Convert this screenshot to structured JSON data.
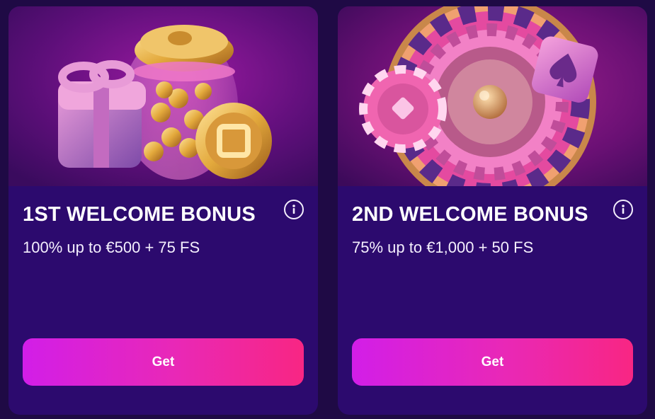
{
  "cards": [
    {
      "title": "1ST WELCOME BONUS",
      "offer": "100% up to €500 + 75 FS",
      "button_label": "Get",
      "image": "gift-box-and-coin-jar-illustration"
    },
    {
      "title": "2ND WELCOME BONUS",
      "offer": "75% up to €1,000 + 50 FS",
      "button_label": "Get",
      "image": "roulette-wheel-with-chip-and-spade-tile-illustration"
    }
  ],
  "colors": {
    "page_background": "#1f0a45",
    "card_background": "#2c0a6e",
    "button_gradient_start": "#d21ee8",
    "button_gradient_end": "#f82683",
    "text": "#ffffff"
  },
  "icons": {
    "info": "info-icon"
  }
}
